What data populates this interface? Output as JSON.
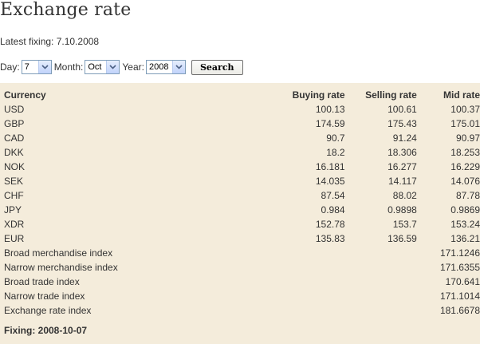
{
  "page": {
    "title": "Exchange rate",
    "latest_fixing": "Latest fixing: 7.10.2008"
  },
  "form": {
    "day_label": "Day:",
    "day_value": "7",
    "month_label": "Month:",
    "month_value": "Oct",
    "year_label": "Year:",
    "year_value": "2008",
    "search_label": "Search"
  },
  "table": {
    "headers": [
      "Currency",
      "Buying rate",
      "Selling rate",
      "Mid rate"
    ],
    "currencies": [
      {
        "name": "USD",
        "buy": "100.13",
        "sell": "100.61",
        "mid": "100.37"
      },
      {
        "name": "GBP",
        "buy": "174.59",
        "sell": "175.43",
        "mid": "175.01"
      },
      {
        "name": "CAD",
        "buy": "90.7",
        "sell": "91.24",
        "mid": "90.97"
      },
      {
        "name": "DKK",
        "buy": "18.2",
        "sell": "18.306",
        "mid": "18.253"
      },
      {
        "name": "NOK",
        "buy": "16.181",
        "sell": "16.277",
        "mid": "16.229"
      },
      {
        "name": "SEK",
        "buy": "14.035",
        "sell": "14.117",
        "mid": "14.076"
      },
      {
        "name": "CHF",
        "buy": "87.54",
        "sell": "88.02",
        "mid": "87.78"
      },
      {
        "name": "JPY",
        "buy": "0.984",
        "sell": "0.9898",
        "mid": "0.9869"
      },
      {
        "name": "XDR",
        "buy": "152.78",
        "sell": "153.7",
        "mid": "153.24"
      },
      {
        "name": "EUR",
        "buy": "135.83",
        "sell": "136.59",
        "mid": "136.21"
      }
    ],
    "indices": [
      {
        "name": "Broad merchandise index",
        "mid": "171.1246"
      },
      {
        "name": "Narrow merchandise index",
        "mid": "171.6355"
      },
      {
        "name": "Broad trade index",
        "mid": "170.641"
      },
      {
        "name": "Narrow trade index",
        "mid": "171.1014"
      },
      {
        "name": "Exchange rate index",
        "mid": "181.6678"
      }
    ]
  },
  "footer": {
    "fixing": "Fixing: 2008-10-07"
  },
  "colors": {
    "panel_background": "#f4ecdb",
    "text": "#333333",
    "select_border": "#7f9db9"
  },
  "icons": {
    "select_arrow": "chevron-down-icon"
  }
}
